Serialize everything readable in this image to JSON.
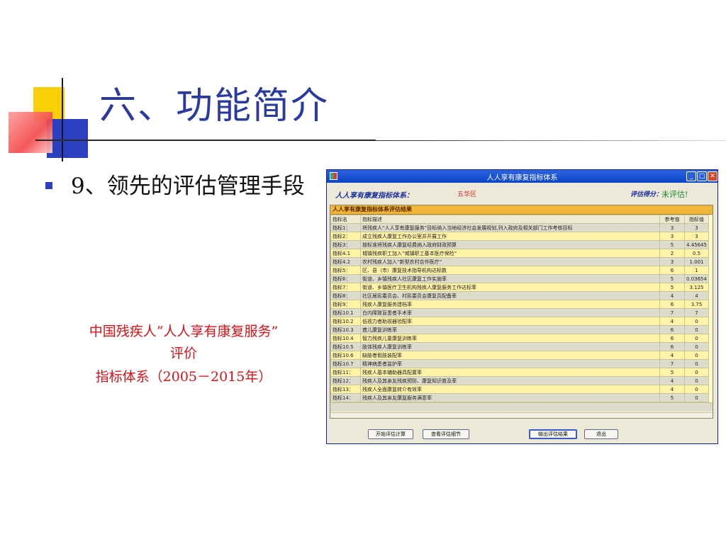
{
  "slide": {
    "title": "六、功能简介",
    "bullet": "9、领先的评估管理手段",
    "caption_line1": "中国残疾人“人人享有康复服务”",
    "caption_line2": "评价",
    "caption_line3": "指标体系（2005－2015年）"
  },
  "window": {
    "title": "人人享有康复指标体系",
    "min_glyph": "_",
    "max_glyph": "□",
    "close_glyph": "✕",
    "header": {
      "system_label": "人人享有康复指标体系：",
      "district": "五华区",
      "score_label": "评估得分：",
      "score_value": "未评估!"
    },
    "grid": {
      "caption": "人人享有康复指标体系评估结果",
      "columns": [
        "指标名",
        "指标描述",
        "参考值",
        "指标值"
      ],
      "rows": [
        [
          "指标1：",
          "将残疾人“人人享有康复服务”目标纳入当地经济社会发展规划,列入政府及相关部门工作考核目标",
          "3",
          "3"
        ],
        [
          "指标2：",
          "成立残疾人康复工作办公室并开展工作",
          "3",
          "3"
        ],
        [
          "指标3：",
          "按标准将残疾人康复经费纳入政府财政预算",
          "5",
          "4.45645"
        ],
        [
          "指标4.1",
          "城镇残疾职工加入“城镇职工基本医疗保险”",
          "2",
          "0.5"
        ],
        [
          "指标4.2",
          "农村残疾人加入“新型农村合作医疗”",
          "3",
          "1.001"
        ],
        [
          "指标5：",
          "区、县（市）康复技术指导机构达标数",
          "6",
          "1"
        ],
        [
          "指标6：",
          "街道、乡镇残疾人社区康复工作实施率",
          "5",
          "0.03654"
        ],
        [
          "指标7：",
          "街道、乡镇医疗卫生机构残疾人康复服务工作达标率",
          "5",
          "3.125"
        ],
        [
          "指标8：",
          "社区居民委员会、村民委员会康复员配备率",
          "4",
          "4"
        ],
        [
          "指标9：",
          "残疾人康复服务建档率",
          "6",
          "3.75"
        ],
        [
          "指标10.1",
          "白内障致盲患者手术率",
          "7",
          "7"
        ],
        [
          "指标10.2",
          "低视力者助视器验配率",
          "4",
          "0"
        ],
        [
          "指标10.3",
          "聋儿康复训练率",
          "6",
          "0"
        ],
        [
          "指标10.4",
          "智力残疾儿童康复训练率",
          "6",
          "0"
        ],
        [
          "指标10.5",
          "肢体残疾人康复训练率",
          "6",
          "0"
        ],
        [
          "指标10.6",
          "缺肢者假肢装配率",
          "4",
          "0"
        ],
        [
          "指标10.7",
          "精神病患者监护率",
          "7",
          "0"
        ],
        [
          "指标11：",
          "残疾人基本辅助器具配置率",
          "5",
          "0"
        ],
        [
          "指标12：",
          "残疾人及其亲友残疾预防、康复知识普及率",
          "4",
          "0"
        ],
        [
          "指标13：",
          "残疾人全面康复转介有效率",
          "4",
          "0"
        ],
        [
          "指标14：",
          "残疾人及其亲友康复服务满意率",
          "5",
          "0"
        ]
      ]
    },
    "buttons": {
      "start": "开始评估计算",
      "details": "查看评估细节",
      "export": "输出评估结果",
      "exit": "退出"
    }
  },
  "colors": {
    "title_blue": "#2b3a9e",
    "caption_red": "#d9121a",
    "grid_yellow": "#fff3a8",
    "grid_caption_orange": "#f1b53a",
    "xp_title_blue": "#0a46c8"
  }
}
